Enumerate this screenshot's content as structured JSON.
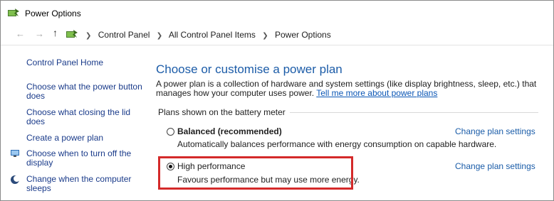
{
  "window": {
    "title": "Power Options",
    "icon": "power-options-icon"
  },
  "address_bar": {
    "back_icon": "back-arrow-icon",
    "forward_icon": "forward-arrow-icon",
    "up_icon": "up-arrow-icon",
    "crumbs": [
      "Control Panel",
      "All Control Panel Items",
      "Power Options"
    ]
  },
  "sidebar": {
    "home": "Control Panel Home",
    "items": [
      "Choose what the power button does",
      "Choose what closing the lid does",
      "Create a power plan",
      "Choose when to turn off the display",
      "Change when the computer sleeps"
    ]
  },
  "main": {
    "title": "Choose or customise a power plan",
    "description": "A power plan is a collection of hardware and system settings (like display brightness, sleep, etc.) that manages how your computer uses power.",
    "description_link": "Tell me more about power plans",
    "section_label": "Plans shown on the battery meter",
    "plans": [
      {
        "name": "Balanced (recommended)",
        "description": "Automatically balances performance with energy consumption on capable hardware.",
        "link": "Change plan settings",
        "selected": false
      },
      {
        "name": "High performance",
        "description": "Favours performance but may use more energy.",
        "link": "Change plan settings",
        "selected": true
      }
    ]
  },
  "colors": {
    "link": "#1a3b8a",
    "title": "#1c5ca8",
    "highlight": "#d42a2a"
  }
}
